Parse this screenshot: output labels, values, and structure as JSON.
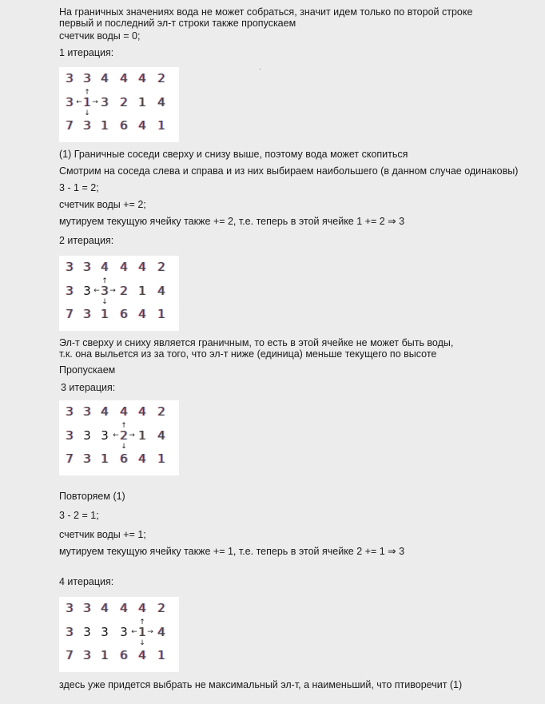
{
  "texts": [
    "На граничных значениях вода не может собраться, значит идем только по второй строке",
    "первый и последний эл-т строки также пропускаем",
    "счетчик воды = 0;",
    "1 итерация:",
    "(1) Граничные соседи сверху и снизу выше, поэтому вода может скопиться",
    "Смотрим на соседа слева и справа и из них выбираем наибольшего (в данном случае одинаковы)",
    "3 - 1 = 2;",
    "счетчик воды += 2;",
    "мутируем текущую ячейку также += 2, т.е. теперь в этой ячейке 1 += 2 ⇒ 3",
    "2 итерация:",
    "Эл-т сверху и сниху является граничным, то есть в этой ячейке не может быть воды,",
    "т.к. она выльется из за того, что эл-т ниже (единица) меньше текущего по высоте",
    "Пропускаем",
    "3 итерация:",
    "Повторяем (1)",
    "3 - 2 = 1;",
    "счетчик воды += 1;",
    "мутируем текущую ячейку также += 1, т.е. теперь в этой ячейке 2 += 1 ⇒ 3",
    "4 итерация:",
    "здесь уже придется выбрать не максимальный эл-т, а наименьший, что птиворечит (1)"
  ],
  "grids": [
    {
      "rows": [
        [
          "3",
          "3",
          "4",
          "4",
          "4",
          "2"
        ],
        [
          "3",
          "1",
          "3",
          "2",
          "1",
          "4"
        ],
        [
          "7",
          "3",
          "1",
          "6",
          "4",
          "1"
        ]
      ],
      "plain_cells": [],
      "focus_col": 1,
      "arrows": {
        "up": "↑",
        "down": "↓",
        "left": "←",
        "right": "→"
      }
    },
    {
      "rows": [
        [
          "3",
          "3",
          "4",
          "4",
          "4",
          "2"
        ],
        [
          "3",
          "3",
          "3",
          "2",
          "1",
          "4"
        ],
        [
          "7",
          "3",
          "1",
          "6",
          "4",
          "1"
        ]
      ],
      "plain_cells": [
        1
      ],
      "focus_col": 2,
      "arrows": {
        "up": "↑",
        "down": "↓",
        "left": "←",
        "right": "→"
      }
    },
    {
      "rows": [
        [
          "3",
          "3",
          "4",
          "4",
          "4",
          "2"
        ],
        [
          "3",
          "3",
          "3",
          "2",
          "1",
          "4"
        ],
        [
          "7",
          "3",
          "1",
          "6",
          "4",
          "1"
        ]
      ],
      "plain_cells": [
        1,
        2
      ],
      "focus_col": 3,
      "arrows": {
        "up": "↑",
        "down": "↓",
        "left": "←",
        "right": "→"
      }
    },
    {
      "rows": [
        [
          "3",
          "3",
          "4",
          "4",
          "4",
          "2"
        ],
        [
          "3",
          "3",
          "3",
          "3",
          "1",
          "4"
        ],
        [
          "7",
          "3",
          "1",
          "6",
          "4",
          "1"
        ]
      ],
      "plain_cells": [
        1,
        2,
        3
      ],
      "focus_col": 4,
      "arrows": {
        "up": "↑",
        "down": "↓",
        "left": "←",
        "right": "→"
      }
    }
  ]
}
